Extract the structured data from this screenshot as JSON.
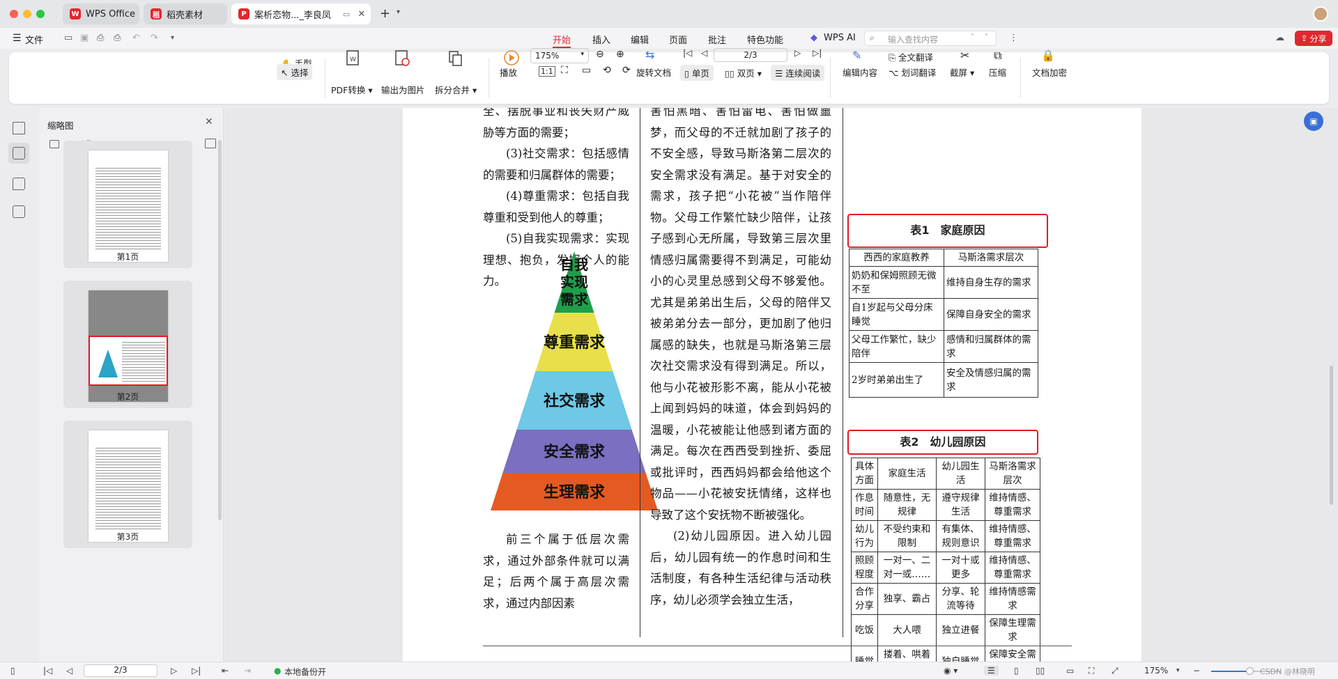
{
  "titlebar": {
    "tabs": [
      {
        "label": "WPS Office",
        "icon": "wps-logo-icon",
        "color": "#e0282e"
      },
      {
        "label": "稻壳素材",
        "icon": "daoke-icon",
        "color": "#e0282e"
      },
      {
        "label": "案析恋物..._李良凤",
        "icon": "pdf-icon",
        "color": "#e0282e"
      }
    ],
    "new_tab": "+"
  },
  "menubar": {
    "file": "文件",
    "items": [
      "开始",
      "插入",
      "编辑",
      "页面",
      "批注",
      "特色功能"
    ],
    "active_index": 0,
    "wps_ai": "WPS AI",
    "search_placeholder": "输入查找内容",
    "share": "分享"
  },
  "ribbon": {
    "hand": "手型",
    "select": "选择",
    "pdf_convert": "PDF转换",
    "export_image": "输出为图片",
    "split_merge": "拆分合并",
    "play": "播放",
    "zoom_value": "175%",
    "page_value": "2/3",
    "rotate": "旋转文档",
    "single": "单页",
    "double": "双页",
    "continuous": "连续阅读",
    "edit_content": "编辑内容",
    "full_translate": "全文翻译",
    "word_translate": "划词翻译",
    "screenshot": "截屏",
    "compress": "压缩",
    "encrypt": "文档加密"
  },
  "thumbpanel": {
    "title": "缩略图",
    "pages": [
      "第1页",
      "第2页",
      "第3页"
    ],
    "current_index": 1,
    "slider_level": 0.12
  },
  "document": {
    "col1_top": [
      "全、摆脱事业和丧失财产威胁等方面的需要；",
      "(3)社交需求：包括感情的需要和归属群体的需要；",
      "(4)尊重需求：包括自我尊重和受到他人的尊重；",
      "(5)自我实现需求：实现理想、抱负，发挥个人的能力。"
    ],
    "pyramid": {
      "levels": [
        {
          "label": "自我实现需求",
          "color": "#1f9f4a"
        },
        {
          "label": "尊重需求",
          "color": "#e8e04a"
        },
        {
          "label": "社交需求",
          "color": "#6ec8e6"
        },
        {
          "label": "安全需求",
          "color": "#7a6fc0"
        },
        {
          "label": "生理需求",
          "color": "#e45a22"
        }
      ]
    },
    "col1_bottom": "前三个属于低层次需求，通过外部条件就可以满足；后两个属于高层次需求，通过内部因素",
    "col2": [
      "害怕黑暗、害怕雷电、害怕做噩梦，而父母的不迁就加剧了孩子的不安全感，导致马斯洛第二层次的安全需求没有满足。基于对安全的需求，孩子把“小花被”当作陪伴物。父母工作繁忙缺少陪伴，让孩子感到心无所属，导致第三层次里情感归属需要得不到满足，可能幼小的心灵里总感到父母不够爱他。尤其是弟弟出生后，父母的陪伴又被弟弟分去一部分，更加剧了他归属感的缺失，也就是马斯洛第三层次社交需求没有得到满足。所以，他与小花被形影不离，能从小花被上闻到妈妈的味道，体会到妈妈的温暖，小花被能让他感到诸方面的满足。每次在西西受到挫折、委屈或批评时，西西妈妈都会给他这个物品——小花被安抚情绪，这样也导致了这个安抚物不断被强化。",
      "(2)幼儿园原因。进入幼儿园后，幼儿园有统一的作息时间和生活制度，有各种生活纪律与活动秩序，幼儿必须学会独立生活，"
    ],
    "table1": {
      "title": "表1　家庭原因",
      "headers": [
        "西西的家庭教养",
        "马斯洛需求层次"
      ],
      "rows": [
        [
          "奶奶和保姆照顾无微不至",
          "维持自身生存的需求"
        ],
        [
          "自1岁起与父母分床睡觉",
          "保障自身安全的需求"
        ],
        [
          "父母工作繁忙，缺少陪伴",
          "感情和归属群体的需求"
        ],
        [
          "2岁时弟弟出生了",
          "安全及情感归属的需求"
        ]
      ]
    },
    "table2": {
      "title": "表2　幼儿园原因",
      "headers": [
        "具体方面",
        "家庭生活",
        "幼儿园生活",
        "马斯洛需求层次"
      ],
      "rows": [
        [
          "作息时间",
          "随意性，无规律",
          "遵守规律生活",
          "维持情感、尊重需求"
        ],
        [
          "幼儿行为",
          "不受约束和限制",
          "有集体、规则意识",
          "维持情感、尊重需求"
        ],
        [
          "照顾程度",
          "一对一、二对一或……",
          "一对十或更多",
          "维持情感、尊重需求"
        ],
        [
          "合作分享",
          "独享、霸占",
          "分享、轮流等待",
          "维持情感需求"
        ],
        [
          "吃饭",
          "大人喂",
          "独立进餐",
          "保障生理需求"
        ],
        [
          "睡觉",
          "搂着、哄着睡觉",
          "独自睡觉",
          "保障安全需求"
        ],
        [
          "……",
          "……",
          "……",
          "……"
        ]
      ]
    }
  },
  "statusbar": {
    "page": "2/3",
    "backup": "本地备份开",
    "zoom": "175%",
    "watermark": "CSDN @林晓明"
  },
  "colors": {
    "accent": "#e0282e",
    "highlight_box": "#e21b23"
  }
}
